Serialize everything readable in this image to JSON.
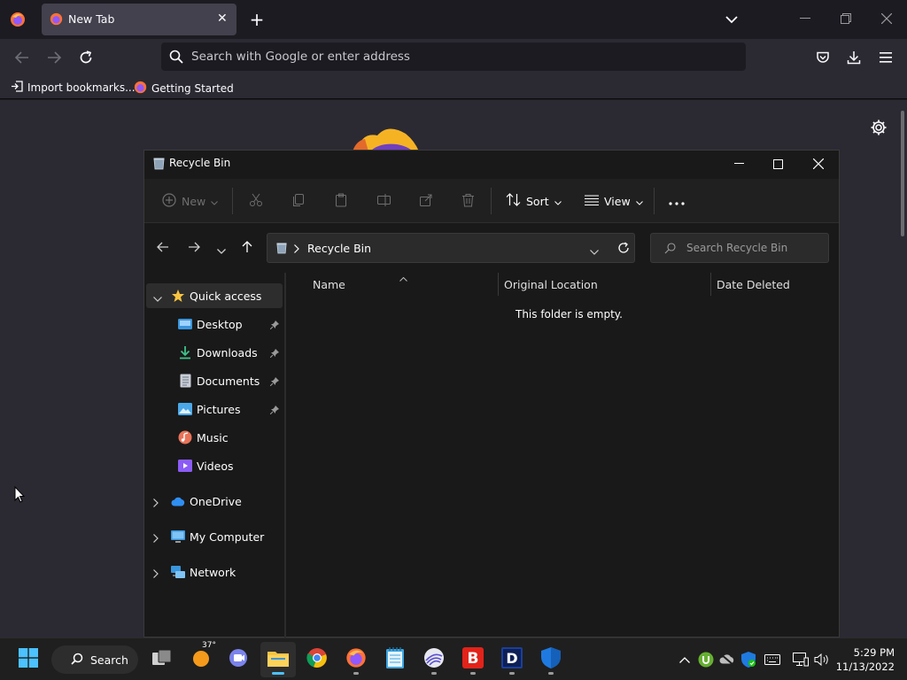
{
  "firefox": {
    "tab_title": "New Tab",
    "url_placeholder": "Search with Google or enter address",
    "bookmarks": [
      {
        "label": "Import bookmarks..."
      },
      {
        "label": "Getting Started"
      }
    ]
  },
  "explorer": {
    "window_title": "Recycle Bin",
    "commands": {
      "new_label": "New",
      "sort_label": "Sort",
      "view_label": "View"
    },
    "address_path": "Recycle Bin",
    "search_placeholder": "Search Recycle Bin",
    "columns": [
      "Name",
      "Original Location",
      "Date Deleted"
    ],
    "empty_message": "This folder is empty.",
    "sidebar": {
      "quick_access": "Quick access",
      "pinned": [
        "Desktop",
        "Downloads",
        "Documents",
        "Pictures"
      ],
      "unpinned": [
        "Music",
        "Videos"
      ],
      "roots": [
        "OneDrive",
        "My Computer",
        "Network"
      ]
    }
  },
  "taskbar": {
    "search_label": "Search",
    "weather_temp": "37°",
    "time": "5:29 PM",
    "date": "11/13/2022"
  },
  "colors": {
    "accent": "#4cc2ff",
    "firefox_toolbar": "#2b2a33",
    "explorer_bg": "#191919"
  }
}
